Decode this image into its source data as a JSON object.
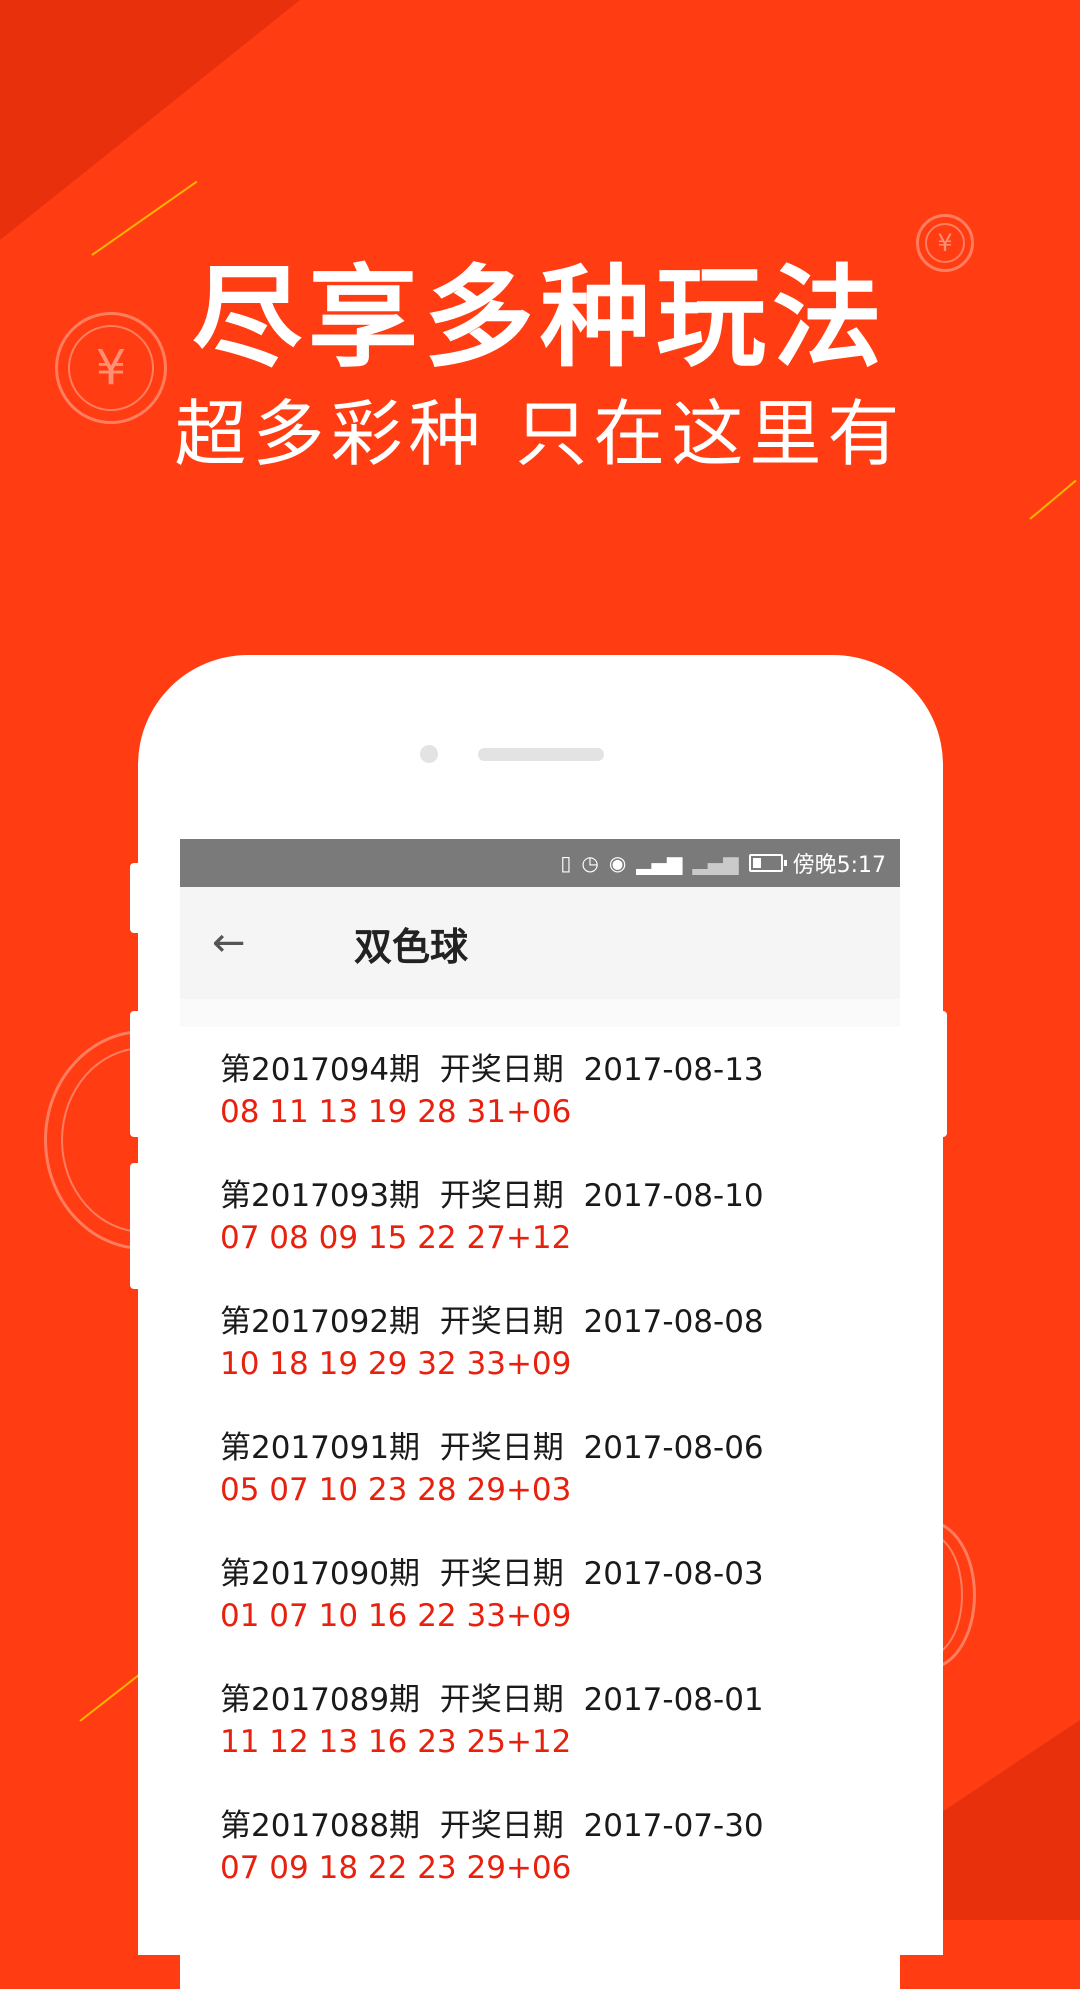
{
  "promo": {
    "headline": "尽享多种玩法",
    "subhead": "超多彩种 只在这里有"
  },
  "coin_glyph": "¥",
  "status_bar": {
    "icons": [
      "vibrate-icon",
      "alarm-icon",
      "eye-icon",
      "4g-signal-icon",
      "signal-icon",
      "battery-icon"
    ],
    "time": "傍晚5:17"
  },
  "app_bar": {
    "back_icon": "arrow-left-icon",
    "title": "双色球"
  },
  "draws": [
    {
      "period": "第2017094期",
      "date_label": "开奖日期",
      "date": "2017-08-13",
      "numbers": "08 11 13 19 28 31+06"
    },
    {
      "period": "第2017093期",
      "date_label": "开奖日期",
      "date": "2017-08-10",
      "numbers": "07 08 09 15 22 27+12"
    },
    {
      "period": "第2017092期",
      "date_label": "开奖日期",
      "date": "2017-08-08",
      "numbers": "10 18 19 29 32 33+09"
    },
    {
      "period": "第2017091期",
      "date_label": "开奖日期",
      "date": "2017-08-06",
      "numbers": "05 07 10 23 28 29+03"
    },
    {
      "period": "第2017090期",
      "date_label": "开奖日期",
      "date": "2017-08-03",
      "numbers": "01 07 10 16 22 33+09"
    },
    {
      "period": "第2017089期",
      "date_label": "开奖日期",
      "date": "2017-08-01",
      "numbers": "11 12 13 16 23 25+12"
    },
    {
      "period": "第2017088期",
      "date_label": "开奖日期",
      "date": "2017-07-30",
      "numbers": "07 09 18 22 23 29+06"
    }
  ],
  "colors": {
    "background": "#ff3c12",
    "number_red": "#e8200e",
    "status_bar": "#7a7a7a"
  }
}
